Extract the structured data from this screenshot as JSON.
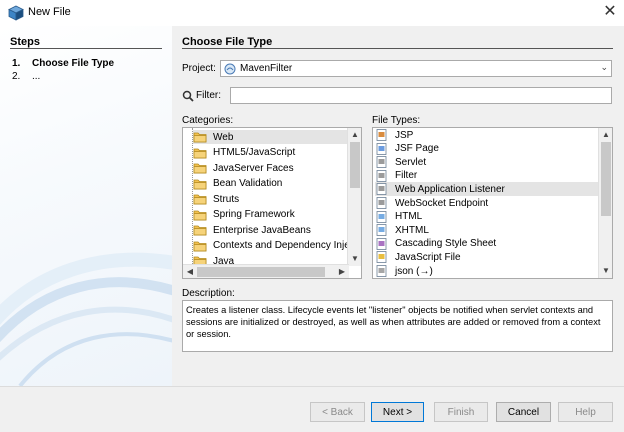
{
  "window": {
    "title": "New File",
    "close_glyph": "✕"
  },
  "steps": {
    "heading": "Steps",
    "items": [
      {
        "num": "1.",
        "label": "Choose File Type"
      },
      {
        "num": "2.",
        "label": "..."
      }
    ]
  },
  "main": {
    "title": "Choose File Type",
    "project_label": "Project:",
    "project_value": "MavenFilter",
    "filter_label": "Filter:",
    "filter_value": "",
    "categories_label": "Categories:",
    "file_types_label": "File Types:",
    "categories": [
      {
        "label": "Web",
        "icon": "folder-icon",
        "selected": true
      },
      {
        "label": "HTML5/JavaScript",
        "icon": "folder-icon"
      },
      {
        "label": "JavaServer Faces",
        "icon": "folder-icon"
      },
      {
        "label": "Bean Validation",
        "icon": "folder-icon"
      },
      {
        "label": "Struts",
        "icon": "folder-icon"
      },
      {
        "label": "Spring Framework",
        "icon": "folder-icon"
      },
      {
        "label": "Enterprise JavaBeans",
        "icon": "folder-icon"
      },
      {
        "label": "Contexts and Dependency Inje",
        "icon": "folder-icon"
      },
      {
        "label": "Java",
        "icon": "folder-icon"
      }
    ],
    "file_types": [
      {
        "label": "JSP",
        "icon": "jsp-file-icon"
      },
      {
        "label": "JSF Page",
        "icon": "jsf-file-icon"
      },
      {
        "label": "Servlet",
        "icon": "servlet-file-icon"
      },
      {
        "label": "Filter",
        "icon": "filter-file-icon"
      },
      {
        "label": "Web Application Listener",
        "icon": "listener-file-icon",
        "selected": true
      },
      {
        "label": "WebSocket Endpoint",
        "icon": "websocket-file-icon"
      },
      {
        "label": "HTML",
        "icon": "html-file-icon"
      },
      {
        "label": "XHTML",
        "icon": "xhtml-file-icon"
      },
      {
        "label": "Cascading Style Sheet",
        "icon": "css-file-icon"
      },
      {
        "label": "JavaScript File",
        "icon": "javascript-file-icon"
      },
      {
        "label": "json (→)",
        "icon": "json-file-icon"
      }
    ],
    "description_label": "Description:",
    "description": "Creates a listener class. Lifecycle events let \"listener\" objects be notified when servlet contexts and sessions are initialized or destroyed, as well as when attributes are added or removed from a context or session."
  },
  "buttons": {
    "back": "< Back",
    "next": "Next >",
    "finish": "Finish",
    "cancel": "Cancel",
    "help": "Help"
  },
  "colors": {
    "selection": "#e4e4e4",
    "default_button_border": "#0078d7",
    "panel_bg": "#f0f0f0"
  }
}
